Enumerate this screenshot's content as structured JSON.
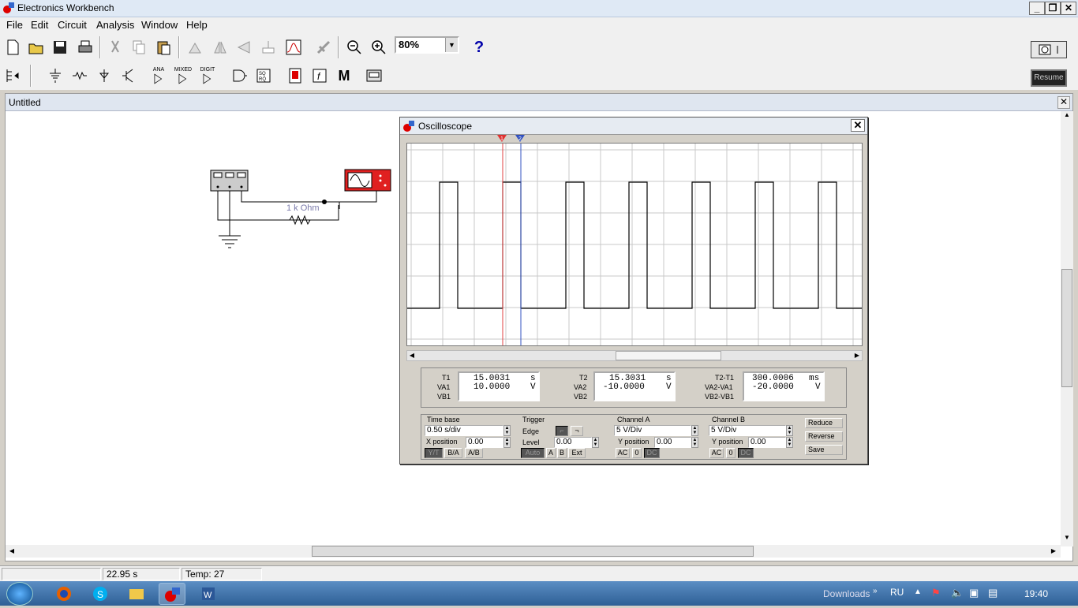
{
  "window": {
    "title": "Electronics Workbench"
  },
  "menu": [
    "File",
    "Edit",
    "Circuit",
    "Analysis",
    "Window",
    "Help"
  ],
  "toolbar": {
    "zoom": "80%",
    "help": "?",
    "resume": "Resume",
    "ana": "ANA",
    "mixed": "MIXED",
    "digit": "DIGIT",
    "m": "M",
    "f": "f"
  },
  "document": {
    "title": "Untitled"
  },
  "circuit": {
    "resistor_label": "1 k Ohm"
  },
  "oscilloscope": {
    "title": "Oscilloscope",
    "cursor1": "1",
    "cursor2": "2",
    "readout": {
      "t1_label": "T1",
      "t1": "15.0031",
      "t1_unit": "s",
      "va1_label": "VA1",
      "va1": "10.0000",
      "va1_unit": "V",
      "vb1_label": "VB1",
      "t2_label": "T2",
      "t2": "15.3031",
      "t2_unit": "s",
      "va2_label": "VA2",
      "va2": "-10.0000",
      "va2_unit": "V",
      "vb2_label": "VB2",
      "dt_label": "T2-T1",
      "dt": "300.0006",
      "dt_unit": "ms",
      "dva_label": "VA2-VA1",
      "dva": "-20.0000",
      "dva_unit": "V",
      "dvb_label": "VB2-VB1"
    },
    "timebase": {
      "label": "Time base",
      "value": "0.50 s/div",
      "xpos_label": "X position",
      "xpos": "0.00",
      "yt": "Y/T",
      "ba": "B/A",
      "ab": "A/B"
    },
    "trigger": {
      "label": "Trigger",
      "edge_label": "Edge",
      "level_label": "Level",
      "level": "0.00",
      "auto": "Auto",
      "a": "A",
      "b": "B",
      "ext": "Ext"
    },
    "channel_a": {
      "label": "Channel A",
      "value": "5  V/Div",
      "ypos_label": "Y position",
      "ypos": "0.00",
      "ac": "AC",
      "zero": "0",
      "dc": "DC"
    },
    "channel_b": {
      "label": "Channel B",
      "value": "5  V/Div",
      "ypos_label": "Y position",
      "ypos": "0.00",
      "ac": "AC",
      "zero": "0",
      "dc": "DC"
    },
    "buttons": {
      "reduce": "Reduce",
      "reverse": "Reverse",
      "save": "Save"
    }
  },
  "status": {
    "time": "22.95 s",
    "temp": "Temp:  27"
  },
  "taskbar": {
    "downloads": "Downloads",
    "lang": "RU",
    "clock": "19:40"
  }
}
